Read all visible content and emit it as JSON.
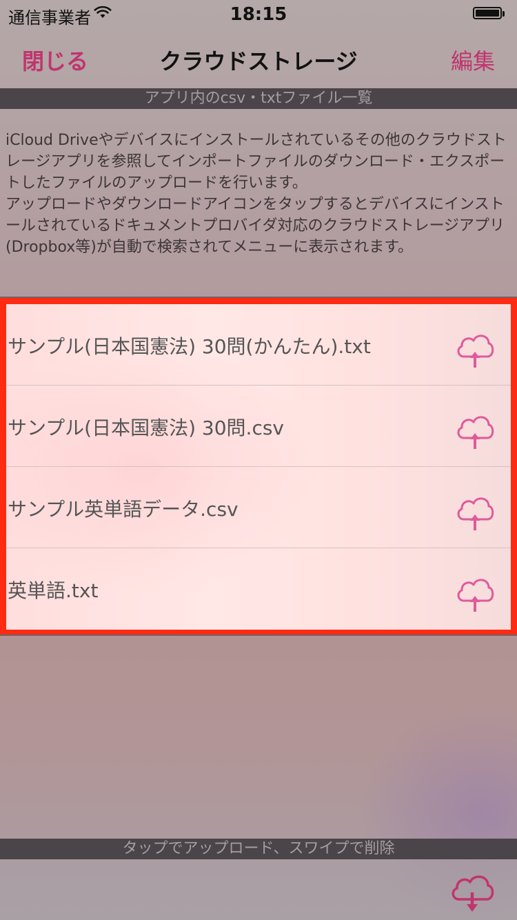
{
  "status_bar": {
    "carrier": "通信事業者",
    "time": "18:15"
  },
  "nav": {
    "left_button": "閉じる",
    "title": "クラウドストレージ",
    "right_button": "編集"
  },
  "section_header": "アプリ内のcsv・txtファイル一覧",
  "description": "iCloud Driveやデバイスにインストールされているその他のクラウドストレージアプリを参照してインポートファイルのダウンロード・エクスポートしたファイルのアップロードを行います。\nアップロードやダウンロードアイコンをタップするとデバイスにインストールされているドキュメントプロバイダ対応のクラウドストレージアプリ(Dropbox等)が自動で検索されてメニューに表示されます。",
  "files": [
    {
      "name": "サンプル(日本国憲法) 30問(かんたん).txt",
      "icon": "cloud-upload-icon"
    },
    {
      "name": "サンプル(日本国憲法) 30問.csv",
      "icon": "cloud-upload-icon"
    },
    {
      "name": "サンプル英単語データ.csv",
      "icon": "cloud-upload-icon"
    },
    {
      "name": "英単語.txt",
      "icon": "cloud-upload-icon"
    }
  ],
  "footer_hint": "タップでアップロード、スワイプで削除",
  "toolbar": {
    "icon": "cloud-download-icon"
  },
  "colors": {
    "accent": "#c0356e",
    "icon_pink": "#e05a9a",
    "highlight_border": "#ff2a12",
    "section_bar": "#4b4448"
  }
}
